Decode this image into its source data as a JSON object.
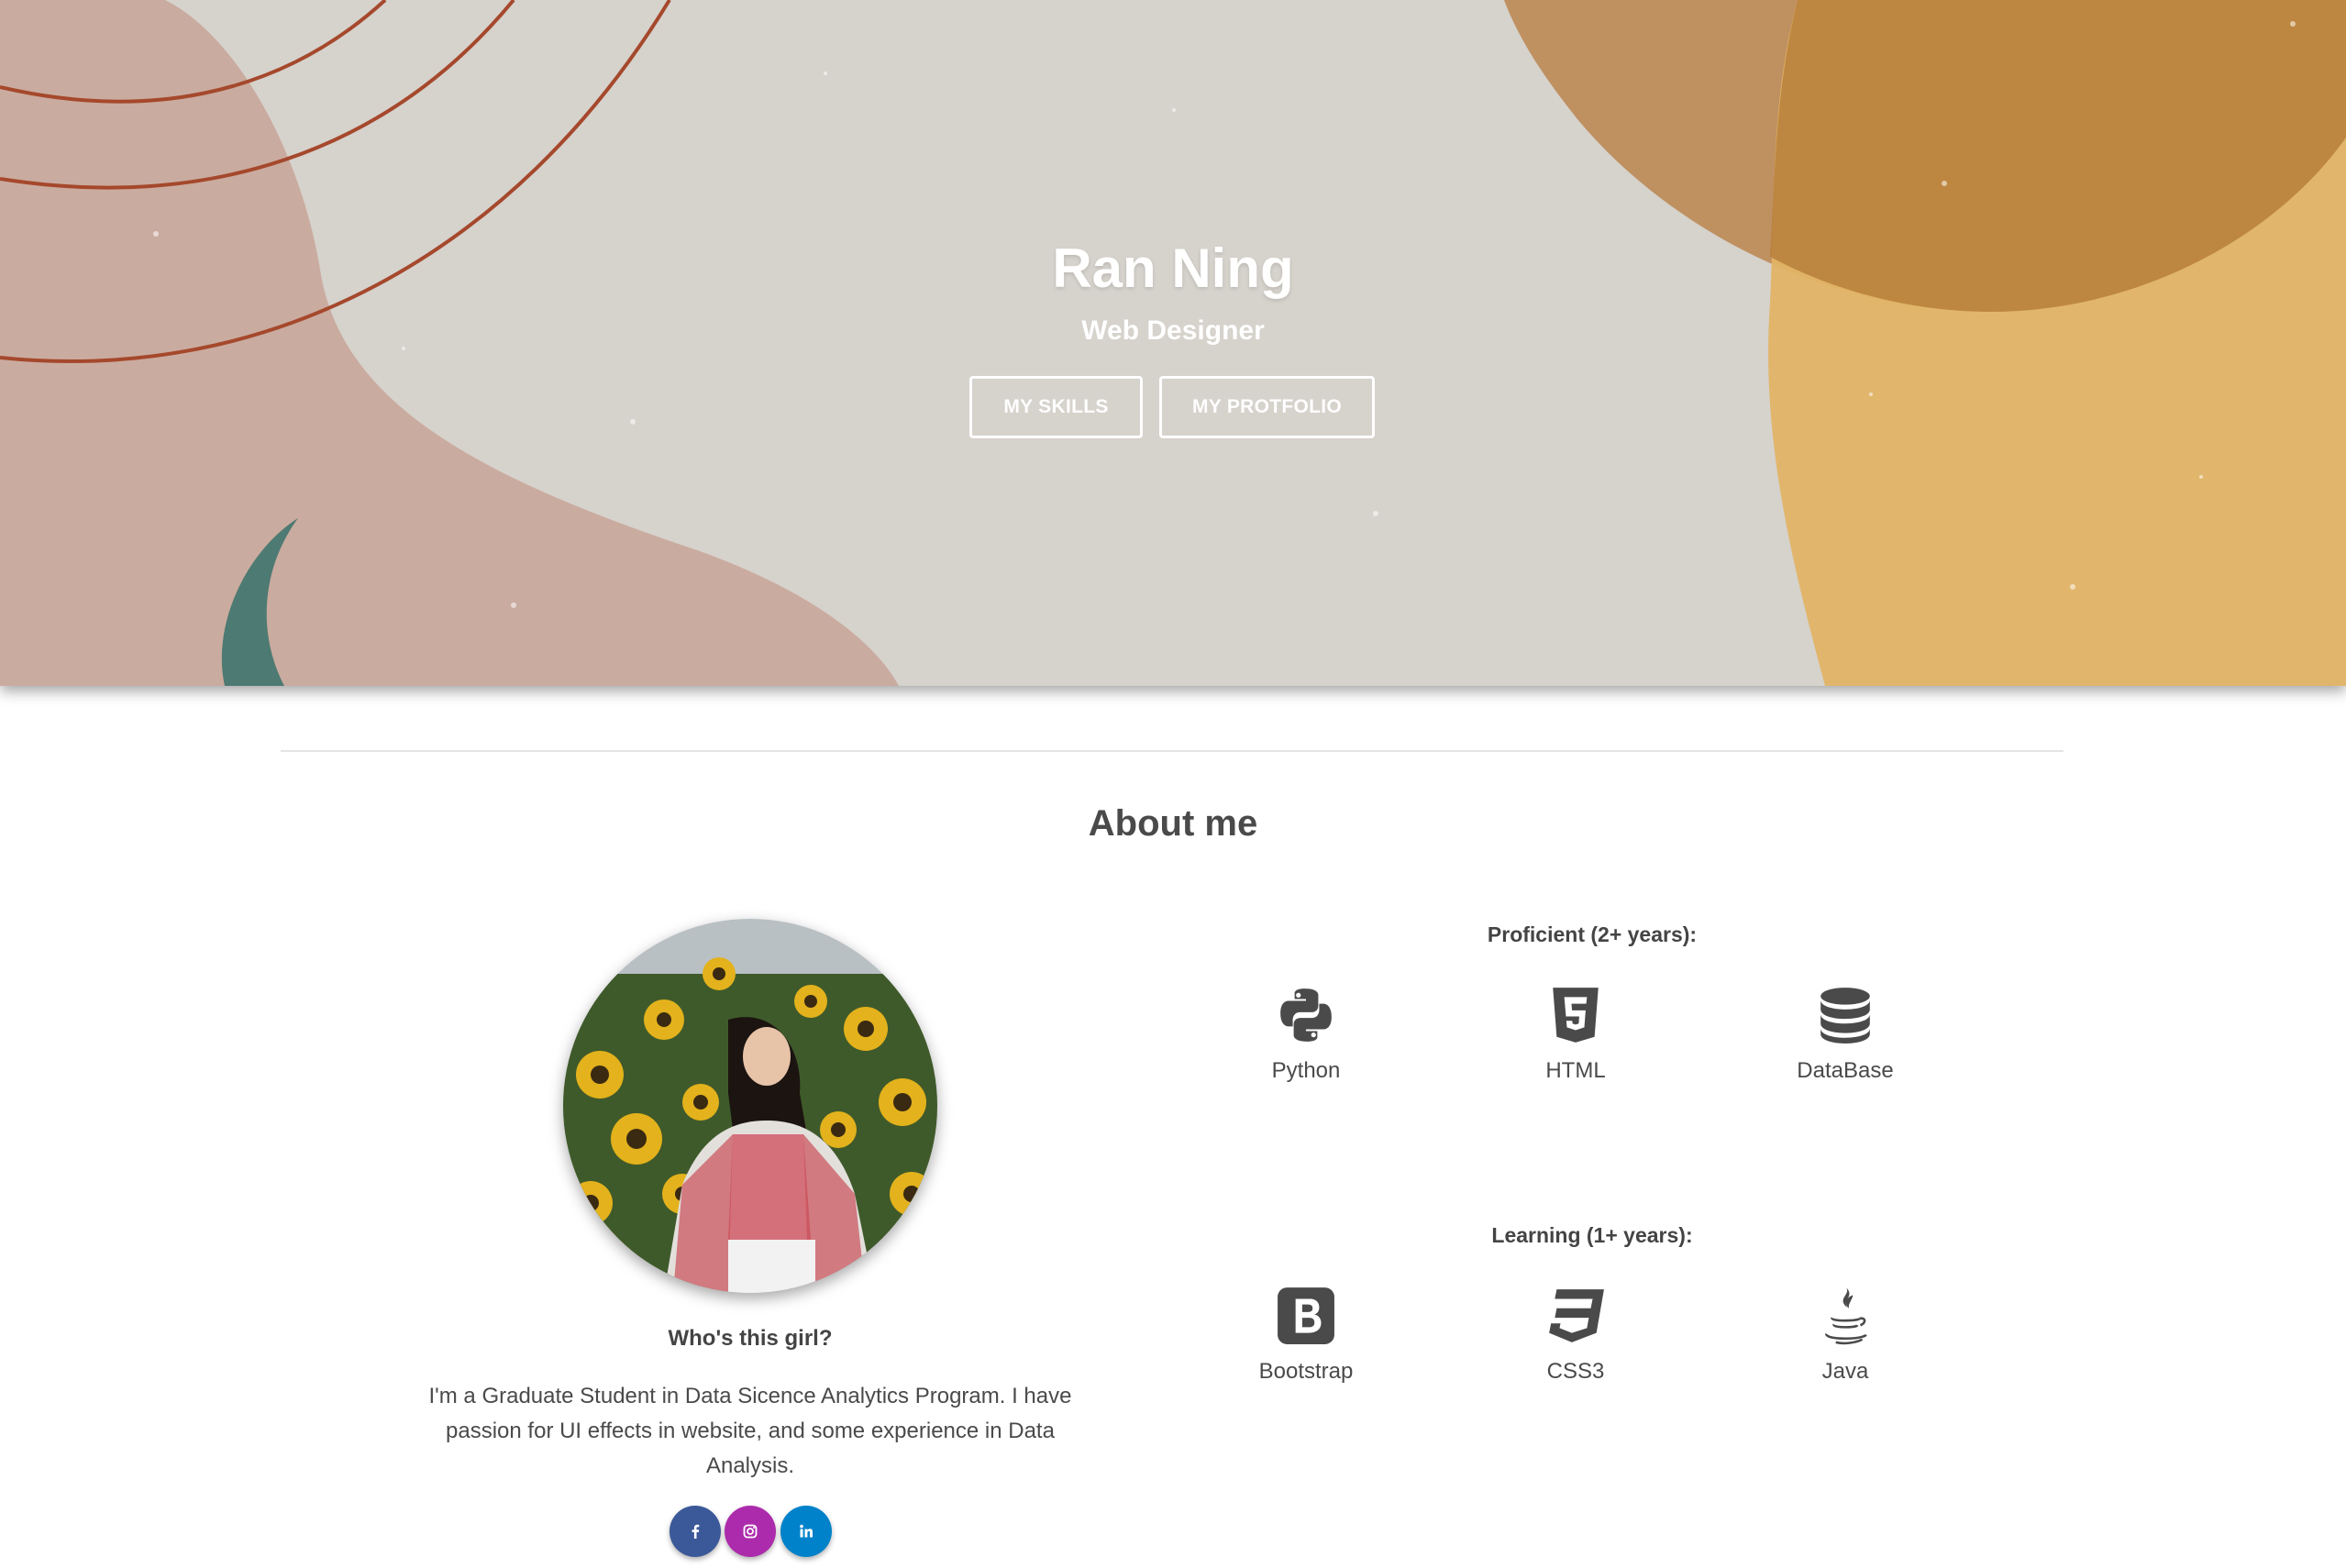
{
  "hero": {
    "name": "Ran Ning",
    "title": "Web Designer",
    "btn_skills": "MY SKILLS",
    "btn_portfolio": "MY PROTFOLIO"
  },
  "about": {
    "heading": "About me",
    "who_heading": "Who's this girl?",
    "bio": "I'm a Graduate Student in Data Sicence Analytics Program. I have passion for UI effects in website, and some experience in Data Analysis.",
    "social": [
      {
        "name": "facebook",
        "icon": "facebook-icon",
        "color": "#3b5998"
      },
      {
        "name": "instagram",
        "icon": "instagram-icon",
        "color": "#ac2bac"
      },
      {
        "name": "linkedin",
        "icon": "linkedin-icon",
        "color": "#0082ca"
      }
    ]
  },
  "skills": {
    "proficient_heading": "Proficient (2+ years):",
    "proficient": [
      {
        "label": "Python",
        "icon": "python-icon"
      },
      {
        "label": "HTML",
        "icon": "html5-icon"
      },
      {
        "label": "DataBase",
        "icon": "database-icon"
      }
    ],
    "learning_heading": "Learning (1+ years):",
    "learning": [
      {
        "label": "Bootstrap",
        "icon": "bootstrap-icon"
      },
      {
        "label": "CSS3",
        "icon": "css3-icon"
      },
      {
        "label": "Java",
        "icon": "java-icon"
      }
    ]
  },
  "colors": {
    "hero_bg": "#d6d2cc",
    "blob_pink": "#c9a79b",
    "blob_orange": "#bd8a55",
    "blob_yellow": "#e2b466",
    "text": "#4a4a4a",
    "icon": "#4a4a4a"
  }
}
